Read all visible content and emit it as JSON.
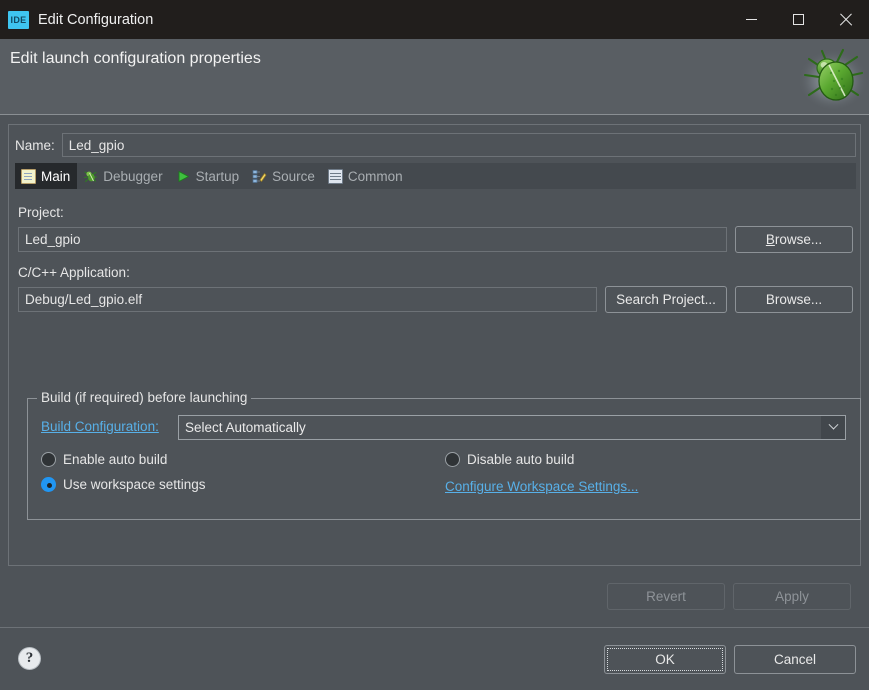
{
  "window": {
    "title": "Edit Configuration",
    "app_icon_label": "IDE",
    "controls": {
      "minimize": "minimize",
      "maximize": "maximize",
      "close": "close"
    }
  },
  "header": {
    "title": "Edit launch configuration properties",
    "decoration_icon": "bug-icon"
  },
  "name_field": {
    "label": "Name:",
    "value": "Led_gpio",
    "placeholder": ""
  },
  "tabs": [
    {
      "label": "Main",
      "icon": "document-icon",
      "active": true
    },
    {
      "label": "Debugger",
      "icon": "bug-icon",
      "active": false
    },
    {
      "label": "Startup",
      "icon": "play-icon",
      "active": false
    },
    {
      "label": "Source",
      "icon": "source-edit-icon",
      "active": false
    },
    {
      "label": "Common",
      "icon": "table-icon",
      "active": false
    }
  ],
  "main_tab": {
    "project": {
      "label": "Project:",
      "value": "Led_gpio",
      "browse_button": "Browse..."
    },
    "application": {
      "label": "C/C++ Application:",
      "value": "Debug/Led_gpio.elf",
      "search_project_button": "Search Project...",
      "browse_button": "Browse..."
    },
    "build_group": {
      "title": "Build (if required) before launching",
      "build_configuration_link": "Build Configuration:",
      "build_configuration_value": "Select Automatically",
      "build_configuration_options": [
        "Select Automatically"
      ],
      "options": [
        {
          "label": "Enable auto build",
          "selected": false
        },
        {
          "label": "Disable auto build",
          "selected": false
        },
        {
          "label": "Use workspace settings",
          "selected": true
        }
      ],
      "configure_workspace_link": "Configure Workspace Settings..."
    }
  },
  "action_buttons": {
    "revert": "Revert",
    "apply": "Apply",
    "revert_enabled": false,
    "apply_enabled": false
  },
  "footer": {
    "help_icon": "?",
    "ok": "OK",
    "cancel": "Cancel"
  },
  "colors": {
    "titlebar": "#211e1c",
    "header": "#595e63",
    "panel": "#4e5358",
    "tabbar": "#44494e",
    "tab_active": "#26292c",
    "link": "#58b0e8",
    "accent_radio": "#2196f3",
    "app_icon": "#3fc5f0",
    "text": "#e6e6e6",
    "border": "#8d9297"
  }
}
